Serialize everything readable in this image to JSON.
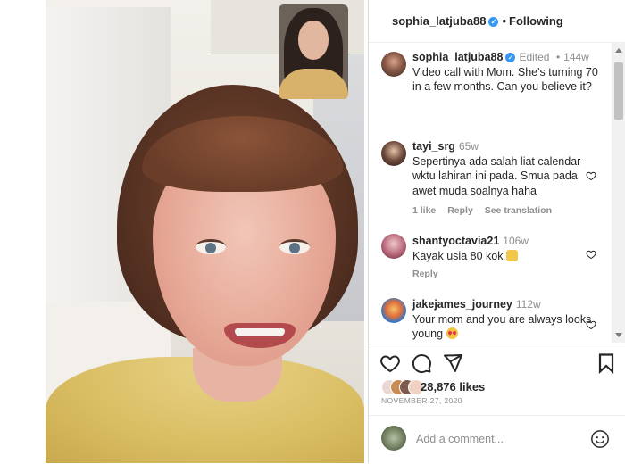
{
  "header": {
    "username": "sophia_latjuba88",
    "separator": "•",
    "follow_status": "Following"
  },
  "caption": {
    "username": "sophia_latjuba88",
    "edited": "Edited",
    "separator": "•",
    "time": "144w",
    "text": "Video call with Mom. She's turning 70 in a few months. Can you believe it?"
  },
  "comments": [
    {
      "username": "tayi_srg",
      "time": "65w",
      "text": "Sepertinya ada salah liat calendar wktu lahiran ini pada. Smua pada awet muda soalnya haha",
      "likes": "1 like",
      "reply": "Reply",
      "translate": "See translation"
    },
    {
      "username": "shantyoctavia21",
      "time": "106w",
      "text": "Kayak usia 80 kok",
      "emoji": "clapping-hands-emoji",
      "reply": "Reply"
    },
    {
      "username": "jakejames_journey",
      "time": "112w",
      "text": "Your mom and you are always looks young",
      "emoji": "smiling-face-with-hearts-emoji"
    }
  ],
  "actions": {
    "likes_count": "28,876 likes",
    "date": "NOVEMBER 27, 2020"
  },
  "add_comment": {
    "placeholder": "Add a comment..."
  },
  "colors": {
    "verified": "#3897f0",
    "text": "#262626",
    "muted": "#8e8e8e",
    "border": "#dbdbdb"
  }
}
